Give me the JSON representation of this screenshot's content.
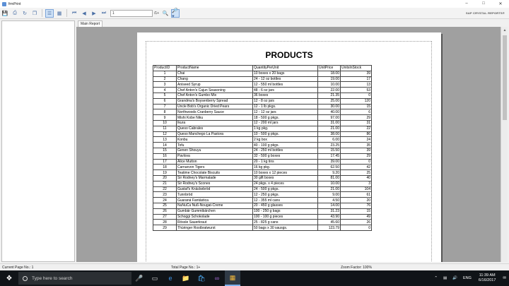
{
  "window": {
    "title": "frmPrint"
  },
  "toolbar": {
    "page_value": "1",
    "page_of": "/1+",
    "brand": "SAP CRYSTAL REPORTS®"
  },
  "tabs": [
    "Main Report"
  ],
  "report": {
    "title": "PRODUCTS",
    "columns": [
      "ProductID",
      "ProductName",
      "QuantityPerUnit",
      "UnitPrice",
      "UnitsInStock"
    ],
    "rows": [
      [
        "1",
        "Chai",
        "10 boxes x 20 bags",
        "18.00",
        "39"
      ],
      [
        "2",
        "Chang",
        "24 - 12 oz bottles",
        "19.00",
        "17"
      ],
      [
        "3",
        "Aniseed Syrup",
        "12 - 550 ml bottles",
        "10.00",
        "13"
      ],
      [
        "4",
        "Chef Anton's Cajun Seasoning",
        "48 - 6 oz jars",
        "22.00",
        "53"
      ],
      [
        "5",
        "Chef Anton's Gumbo Mix",
        "36 boxes",
        "21.35",
        "0"
      ],
      [
        "6",
        "Grandma's Boysenberry Spread",
        "12 - 8 oz jars",
        "25.00",
        "120"
      ],
      [
        "7",
        "Uncle Bob's Organic Dried Pears",
        "12 - 1 lb pkgs.",
        "30.00",
        "15"
      ],
      [
        "8",
        "Northwoods Cranberry Sauce",
        "12 - 12 oz jars",
        "40.00",
        "6"
      ],
      [
        "9",
        "Mishi Kobe Niku",
        "18 - 500 g pkgs.",
        "97.00",
        "29"
      ],
      [
        "10",
        "Ikura",
        "12 - 200 ml jars",
        "31.00",
        "31"
      ],
      [
        "11",
        "Queso Cabrales",
        "1 kg pkg.",
        "21.00",
        "22"
      ],
      [
        "12",
        "Queso Manchego La Pastora",
        "10 - 500 g pkgs.",
        "38.00",
        "86"
      ],
      [
        "13",
        "Konbu",
        "2 kg box",
        "6.00",
        "24"
      ],
      [
        "14",
        "Tofu",
        "40 - 100 g pkgs.",
        "23.25",
        "35"
      ],
      [
        "15",
        "Genen Shouyu",
        "24 - 250 ml bottles",
        "15.50",
        "39"
      ],
      [
        "16",
        "Pavlova",
        "32 - 500 g boxes",
        "17.45",
        "29"
      ],
      [
        "17",
        "Alice Mutton",
        "20 - 1 kg tins",
        "39.00",
        "0"
      ],
      [
        "18",
        "Carnarvon Tigers",
        "16 kg pkg.",
        "62.50",
        "42"
      ],
      [
        "19",
        "Teatime Chocolate Biscuits",
        "10 boxes x 12 pieces",
        "9.20",
        "25"
      ],
      [
        "20",
        "Sir Rodney's Marmalade",
        "30 gift boxes",
        "81.00",
        "40"
      ],
      [
        "21",
        "Sir Rodney's Scones",
        "24 pkgs. x 4 pieces",
        "10.00",
        "3"
      ],
      [
        "22",
        "Gustaf's Knäckebröd",
        "24 - 500 g pkgs.",
        "21.00",
        "104"
      ],
      [
        "23",
        "Tunnbröd",
        "12 - 250 g pkgs.",
        "9.00",
        "61"
      ],
      [
        "24",
        "Guaraná Fantástica",
        "12 - 355 ml cans",
        "4.50",
        "20"
      ],
      [
        "25",
        "NuNuCa Nuß-Nougat-Creme",
        "20 - 450 g glasses",
        "14.00",
        "76"
      ],
      [
        "26",
        "Gumbär Gummibärchen",
        "100 - 250 g bags",
        "31.23",
        "15"
      ],
      [
        "27",
        "Schoggi Schokolade",
        "100 - 100 g pieces",
        "43.90",
        "49"
      ],
      [
        "28",
        "Rössle Sauerkraut",
        "25 - 825 g cans",
        "45.60",
        "26"
      ],
      [
        "29",
        "Thüringer Rostbratwurst",
        "50 bags x 30 sausgs.",
        "123.79",
        "0"
      ]
    ]
  },
  "status": {
    "current_page": "Current Page No.: 1",
    "total_page": "Total Page No.: 1+",
    "zoom": "Zoom Factor: 100%"
  },
  "taskbar": {
    "search_placeholder": "Type here to search",
    "language": "ENG",
    "time": "11:39 AM",
    "date": "6/16/2017"
  }
}
